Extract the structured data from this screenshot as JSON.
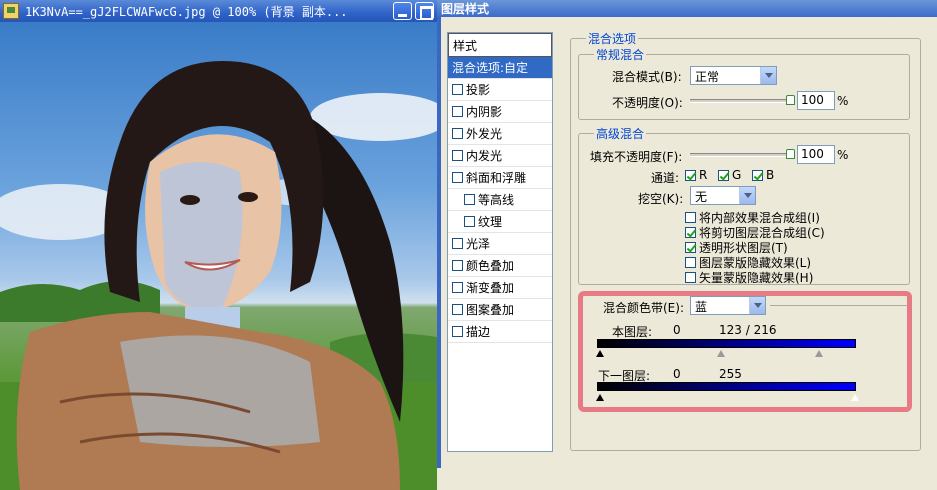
{
  "image_window": {
    "title": "1K3NvA==_gJ2FLCWAFwcG.jpg @ 100% (背景 副本...",
    "icon": "document-image-icon"
  },
  "dialog": {
    "title": "图层样式",
    "styles_header": "样式",
    "styles_list": [
      {
        "label": "混合选项:自定",
        "checkbox": false,
        "selected": true
      },
      {
        "label": "投影",
        "checkbox": true,
        "checked": false
      },
      {
        "label": "内阴影",
        "checkbox": true,
        "checked": false
      },
      {
        "label": "外发光",
        "checkbox": true,
        "checked": false
      },
      {
        "label": "内发光",
        "checkbox": true,
        "checked": false
      },
      {
        "label": "斜面和浮雕",
        "checkbox": true,
        "checked": false
      },
      {
        "label": "等高线",
        "checkbox": true,
        "checked": false,
        "sub": true
      },
      {
        "label": "纹理",
        "checkbox": true,
        "checked": false,
        "sub": true
      },
      {
        "label": "光泽",
        "checkbox": true,
        "checked": false
      },
      {
        "label": "颜色叠加",
        "checkbox": true,
        "checked": false
      },
      {
        "label": "渐变叠加",
        "checkbox": true,
        "checked": false
      },
      {
        "label": "图案叠加",
        "checkbox": true,
        "checked": false
      },
      {
        "label": "描边",
        "checkbox": true,
        "checked": false
      }
    ],
    "blend_options_title": "混合选项",
    "general": {
      "title": "常规混合",
      "mode_label": "混合模式(B):",
      "mode_value": "正常",
      "opacity_label": "不透明度(O):",
      "opacity_value": "100",
      "opacity_unit": "%"
    },
    "advanced": {
      "title": "高级混合",
      "fill_label": "填充不透明度(F):",
      "fill_value": "100",
      "fill_unit": "%",
      "channels_label": "通道:",
      "channels": [
        {
          "label": "R",
          "checked": true
        },
        {
          "label": "G",
          "checked": true
        },
        {
          "label": "B",
          "checked": true
        }
      ],
      "knockout_label": "挖空(K):",
      "knockout_value": "无",
      "options": [
        {
          "label": "将内部效果混合成组(I)",
          "checked": false
        },
        {
          "label": "将剪切图层混合成组(C)",
          "checked": true
        },
        {
          "label": "透明形状图层(T)",
          "checked": true
        },
        {
          "label": "图层蒙版隐藏效果(L)",
          "checked": false
        },
        {
          "label": "矢量蒙版隐藏效果(H)",
          "checked": false
        }
      ]
    },
    "blend_if": {
      "label": "混合颜色带(E):",
      "value": "蓝",
      "this_layer_label": "本图层:",
      "this_layer_low": "0",
      "this_layer_high": "123 / 216",
      "underlying_label": "下一图层:",
      "underlying_low": "0",
      "underlying_high": "255",
      "bar_color": "#0000ff"
    }
  }
}
